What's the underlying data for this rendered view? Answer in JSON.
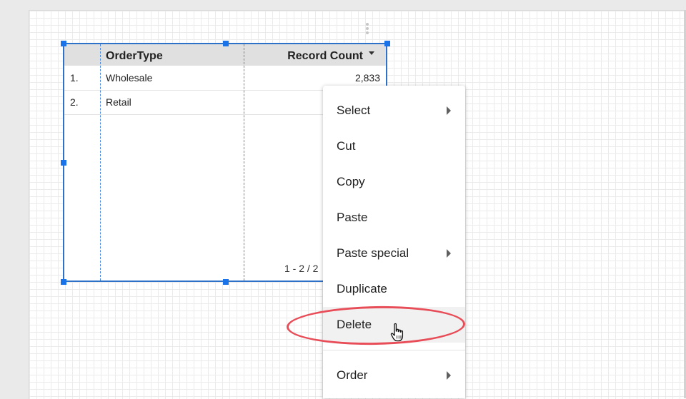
{
  "table": {
    "header": {
      "order_type": "OrderType",
      "record_count": "Record Count"
    },
    "sort_icon": "sort-descending-icon",
    "rows": [
      {
        "index": "1.",
        "order_type": "Wholesale",
        "record_count": "2,833"
      },
      {
        "index": "2.",
        "order_type": "Retail",
        "record_count": ""
      }
    ],
    "pagination": "1 - 2 / 2"
  },
  "context_menu": {
    "items": [
      {
        "label": "Select",
        "submenu": true
      },
      {
        "label": "Cut",
        "submenu": false
      },
      {
        "label": "Copy",
        "submenu": false
      },
      {
        "label": "Paste",
        "submenu": false
      },
      {
        "label": "Paste special",
        "submenu": true
      },
      {
        "label": "Duplicate",
        "submenu": false
      },
      {
        "label": "Delete",
        "submenu": false,
        "hovered": true
      },
      {
        "label": "Order",
        "submenu": true
      }
    ]
  },
  "colors": {
    "selection": "#1a73e8",
    "highlight_annotation": "#e84c57",
    "header_background": "#e0e0e0"
  },
  "icons": {
    "more": "more-vert-icon",
    "submenu": "chevron-right-icon",
    "cursor": "hand-pointer-icon"
  }
}
